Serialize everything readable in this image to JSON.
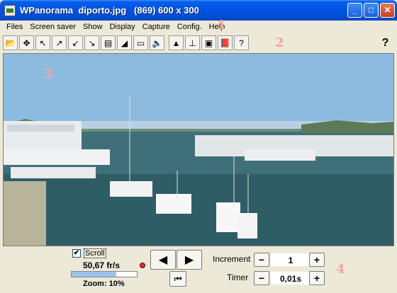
{
  "window": {
    "title": "WPanorama  diporto.jpg   (869) 600 x 300",
    "buttons": {
      "minimize": "_",
      "maximize": "□",
      "close": "✕"
    }
  },
  "menu": [
    "Files",
    "Screen saver",
    "Show",
    "Display",
    "Capture",
    "Config.",
    "Help"
  ],
  "toolbar": {
    "buttons": [
      {
        "icon": "open-file-icon",
        "glyph": "📂"
      },
      {
        "icon": "center-arrows-icon",
        "glyph": "✥"
      },
      {
        "icon": "arrow-up-left-icon",
        "glyph": "↖"
      },
      {
        "icon": "arrow-up-right-icon",
        "glyph": "↗"
      },
      {
        "icon": "arrow-down-left-icon",
        "glyph": "↙"
      },
      {
        "icon": "arrow-down-right-icon",
        "glyph": "↘"
      },
      {
        "icon": "image-icon",
        "glyph": "▤"
      },
      {
        "icon": "landscape-icon",
        "glyph": "◢"
      },
      {
        "icon": "panorama-strip-icon",
        "glyph": "▭"
      },
      {
        "icon": "speaker-icon",
        "glyph": "🔈"
      },
      {
        "icon": "mountain-icon",
        "glyph": "▲"
      },
      {
        "icon": "tree-icon",
        "glyph": "⊥"
      },
      {
        "icon": "window-icon",
        "glyph": "▣"
      },
      {
        "icon": "book-icon",
        "glyph": "📕"
      },
      {
        "icon": "help-book-icon",
        "glyph": "?"
      }
    ],
    "help": "?"
  },
  "annotations": {
    "n1": "1",
    "n2": "2",
    "n3": "3",
    "n4": "4"
  },
  "controls": {
    "scroll_label": "Scroll",
    "scroll_checked": true,
    "fps": "50,67 fr/s",
    "zoom_label": "Zoom: 10%",
    "zoom_fraction": 0.68,
    "increment_label": "Increment",
    "increment_value": "1",
    "timer_label": "Timer",
    "timer_value": "0,01s",
    "minus": "−",
    "plus": "+",
    "left_arrow": "◀",
    "right_arrow": "▶",
    "first_frame": "⏮"
  }
}
